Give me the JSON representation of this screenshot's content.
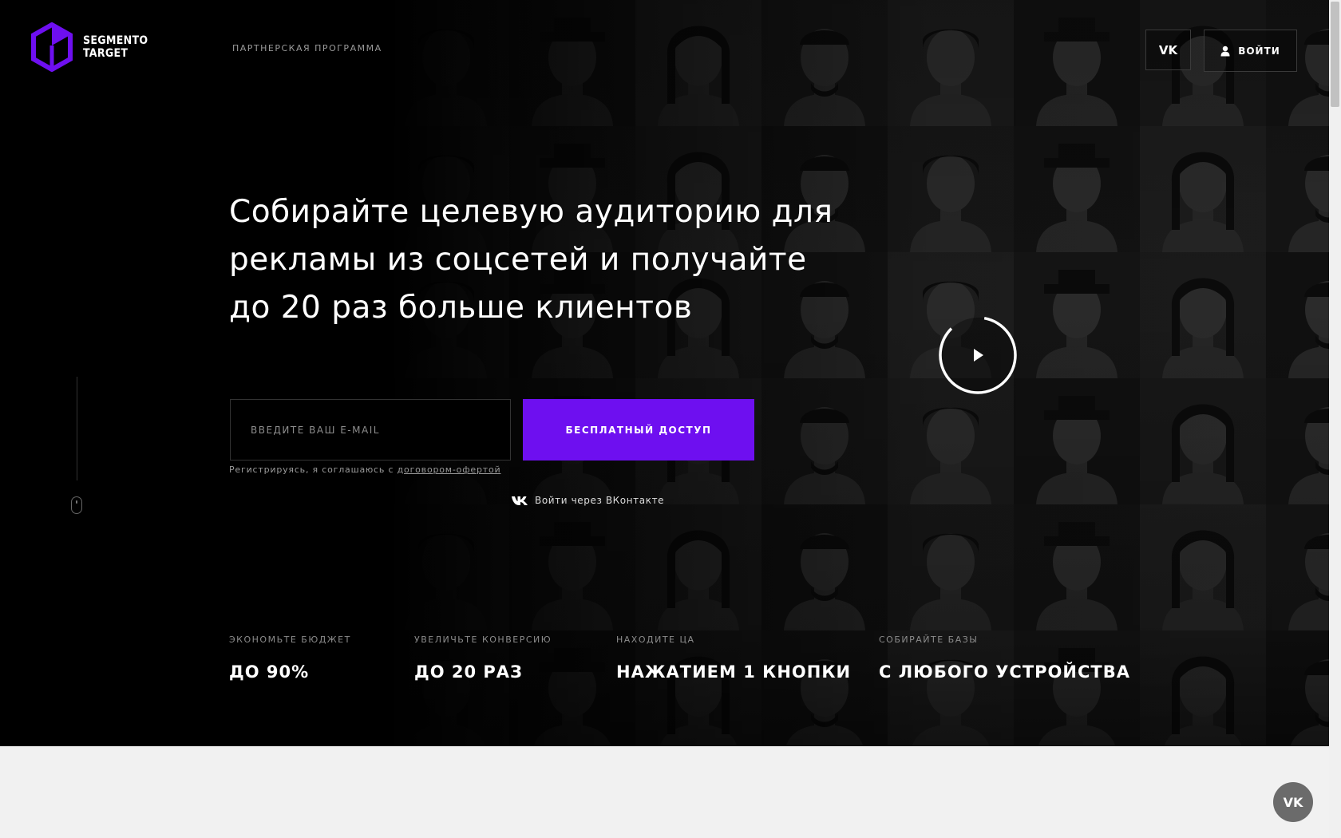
{
  "brand": {
    "line1": "SEGMENTO",
    "line2": "TARGET",
    "accent": "#6e0ff0"
  },
  "nav": {
    "partner_label": "ПАРТНЕРСКАЯ ПРОГРАММА"
  },
  "header": {
    "vk_label": "VK",
    "login_label": "ВОЙТИ"
  },
  "hero": {
    "headline_1": "Собирайте целевую аудиторию для",
    "headline_2": "рекламы из соцсетей и получайте",
    "headline_3": "до 20 раз больше клиентов"
  },
  "form": {
    "email_placeholder": "ВВЕДИТЕ ВАШ E-MAIL",
    "cta_label": "БЕСПЛАТНЫЙ ДОСТУП",
    "agree_text": "Регистрируясь, я соглашаюсь с ",
    "agree_link": "договором-офертой",
    "vk_login_label": "Войти через ВКонтакте"
  },
  "stats": [
    {
      "label": "ЭКОНОМЬТЕ БЮДЖЕТ",
      "value": "ДО 90%"
    },
    {
      "label": "УВЕЛИЧЬТЕ КОНВЕРСИЮ",
      "value": "ДО 20 РАЗ"
    },
    {
      "label": "НАХОДИТЕ ЦА",
      "value": "НАЖАТИЕМ 1 КНОПКИ"
    },
    {
      "label": "СОБИРАЙТЕ БАЗЫ",
      "value": "С ЛЮБОГО УСТРОЙСТВА"
    }
  ],
  "floating": {
    "vk_label": "VK"
  },
  "icons": [
    "logo-hexagon-icon",
    "vk-icon",
    "user-icon",
    "play-icon",
    "mouse-scroll-icon"
  ]
}
